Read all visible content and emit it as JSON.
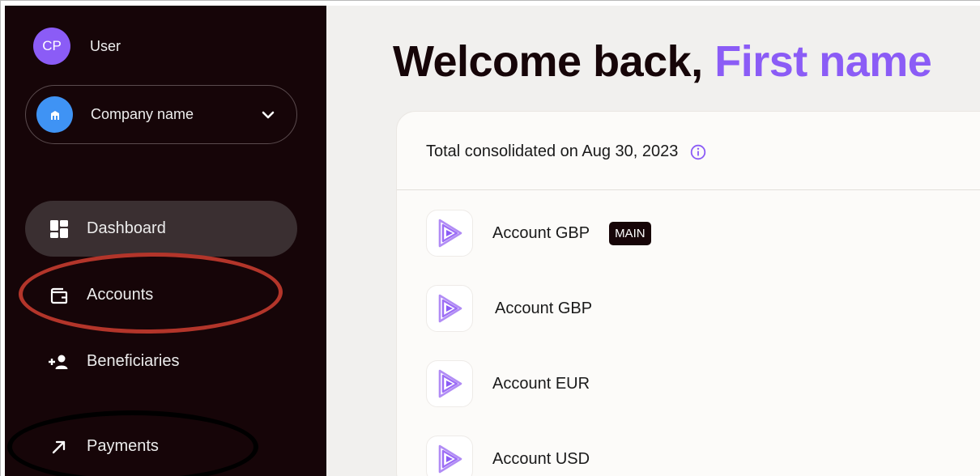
{
  "user": {
    "initials": "CP",
    "name": "User"
  },
  "company": {
    "name": "Company name"
  },
  "nav": {
    "items": [
      {
        "label": "Dashboard",
        "icon": "dashboard-icon",
        "active": true
      },
      {
        "label": "Accounts",
        "icon": "wallet-icon",
        "active": false
      },
      {
        "label": "Beneficiaries",
        "icon": "add-person-icon",
        "active": false
      },
      {
        "label": "Payments",
        "icon": "arrow-up-right-icon",
        "active": false
      }
    ]
  },
  "main": {
    "welcome_prefix": "Welcome back,",
    "welcome_name": "First name",
    "total_label": "Total consolidated on Aug 30, 2023",
    "accounts": [
      {
        "label": "Account GBP",
        "badge": "MAIN"
      },
      {
        "label": "Account GBP"
      },
      {
        "label": "Account EUR"
      },
      {
        "label": "Account USD"
      }
    ]
  },
  "colors": {
    "sidebar_bg": "#160508",
    "accent_purple": "#8b5cf6",
    "company_icon_blue": "#3f93f4",
    "annotation_red": "#b3352a",
    "annotation_black": "#000000"
  }
}
